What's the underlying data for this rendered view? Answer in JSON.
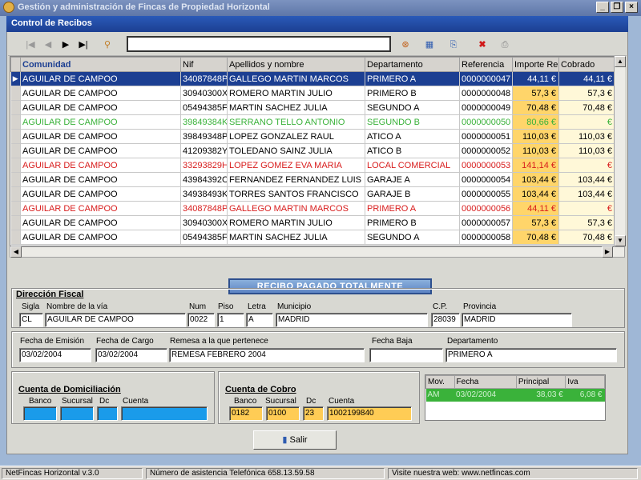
{
  "window": {
    "title": "Gestión y administración de Fincas de Propiedad Horizontal"
  },
  "form": {
    "title": "Control de Recibos"
  },
  "grid": {
    "columns": [
      "Comunidad",
      "Nif",
      "Apellidos y nombre",
      "Departamento",
      "Referencia",
      "Importe Re",
      "Cobrado"
    ],
    "rows": [
      [
        "AGUILAR DE CAMPOO",
        "34087848P",
        "GALLEGO MARTIN MARCOS",
        "PRIMERO A",
        "0000000047",
        "44,11 €",
        "44,11 €"
      ],
      [
        "AGUILAR DE CAMPOO",
        "30940300X",
        "ROMERO MARTIN JULIO",
        "PRIMERO B",
        "0000000048",
        "57,3 €",
        "57,3 €"
      ],
      [
        "AGUILAR DE CAMPOO",
        "05494385F",
        "MARTIN SACHEZ JULIA",
        "SEGUNDO A",
        "0000000049",
        "70,48 €",
        "70,48 €"
      ],
      [
        "AGUILAR DE CAMPOO",
        "39849384K",
        "SERRANO TELLO ANTONIO",
        "SEGUNDO B",
        "0000000050",
        "80,66 €",
        "€"
      ],
      [
        "AGUILAR DE CAMPOO",
        "39849348P",
        "LOPEZ GONZALEZ RAUL",
        "ATICO A",
        "0000000051",
        "110,03 €",
        "110,03 €"
      ],
      [
        "AGUILAR DE CAMPOO",
        "41209382Y",
        "TOLEDANO SAINZ JULIA",
        "ATICO B",
        "0000000052",
        "110,03 €",
        "110,03 €"
      ],
      [
        "AGUILAR DE CAMPOO",
        "33293829H",
        "LOPEZ GOMEZ EVA MARIA",
        "LOCAL COMERCIAL",
        "0000000053",
        "141,14 €",
        "€"
      ],
      [
        "AGUILAR DE CAMPOO",
        "43984392C",
        "FERNANDEZ FERNANDEZ LUIS",
        "GARAJE A",
        "0000000054",
        "103,44 €",
        "103,44 €"
      ],
      [
        "AGUILAR DE CAMPOO",
        "34938493K",
        "TORRES SANTOS FRANCISCO",
        "GARAJE B",
        "0000000055",
        "103,44 €",
        "103,44 €"
      ],
      [
        "AGUILAR DE CAMPOO",
        "34087848P",
        "GALLEGO MARTIN MARCOS",
        "PRIMERO A",
        "0000000056",
        "44,11 €",
        "€"
      ],
      [
        "AGUILAR DE CAMPOO",
        "30940300X",
        "ROMERO MARTIN JULIO",
        "PRIMERO B",
        "0000000057",
        "57,3 €",
        "57,3 €"
      ],
      [
        "AGUILAR DE CAMPOO",
        "05494385F",
        "MARTIN SACHEZ JULIA",
        "SEGUNDO A",
        "0000000058",
        "70,48 €",
        "70,48 €"
      ]
    ]
  },
  "status_banner": "RECIBO PAGADO TOTALMENTE",
  "fiscal": {
    "title": "Dirección Fiscal",
    "labels": {
      "sigla": "Sigla",
      "via": "Nombre de la vía",
      "num": "Num",
      "piso": "Piso",
      "letra": "Letra",
      "municipio": "Municipio",
      "cp": "C.P.",
      "provincia": "Provincia"
    },
    "values": {
      "sigla": "CL",
      "via": "AGUILAR DE CAMPOO",
      "num": "0022",
      "piso": "1",
      "letra": "A",
      "municipio": "MADRID",
      "cp": "28039",
      "provincia": "MADRID"
    }
  },
  "dates": {
    "labels": {
      "emision": "Fecha de Emisión",
      "cargo": "Fecha de Cargo",
      "remesa": "Remesa a la que pertenece",
      "baja": "Fecha Baja",
      "departamento": "Departamento"
    },
    "values": {
      "emision": "03/02/2004",
      "cargo": "03/02/2004",
      "remesa": "REMESA FEBRERO 2004",
      "baja": "",
      "departamento": "PRIMERO A"
    }
  },
  "domiciliacion": {
    "title": "Cuenta de Domiciliación",
    "labels": {
      "banco": "Banco",
      "sucursal": "Sucursal",
      "dc": "Dc",
      "cuenta": "Cuenta"
    },
    "values": {
      "banco": "",
      "sucursal": "",
      "dc": "",
      "cuenta": ""
    }
  },
  "cobro": {
    "title": "Cuenta de Cobro",
    "labels": {
      "banco": "Banco",
      "sucursal": "Sucursal",
      "dc": "Dc",
      "cuenta": "Cuenta"
    },
    "values": {
      "banco": "0182",
      "sucursal": "0100",
      "dc": "23",
      "cuenta": "1002199840"
    }
  },
  "movements": {
    "columns": [
      "Mov.",
      "Fecha",
      "Principal",
      "Iva"
    ],
    "rows": [
      [
        "AM",
        "03/02/2004",
        "38,03 €",
        "6,08 €"
      ]
    ]
  },
  "buttons": {
    "salir": "Salir"
  },
  "statusbar": {
    "version": "NetFincas Horizontal v.3.0",
    "phone": "Número de asistencia Telefónica  658.13.59.58",
    "web": "Visite nuestra web: www.netfincas.com"
  }
}
